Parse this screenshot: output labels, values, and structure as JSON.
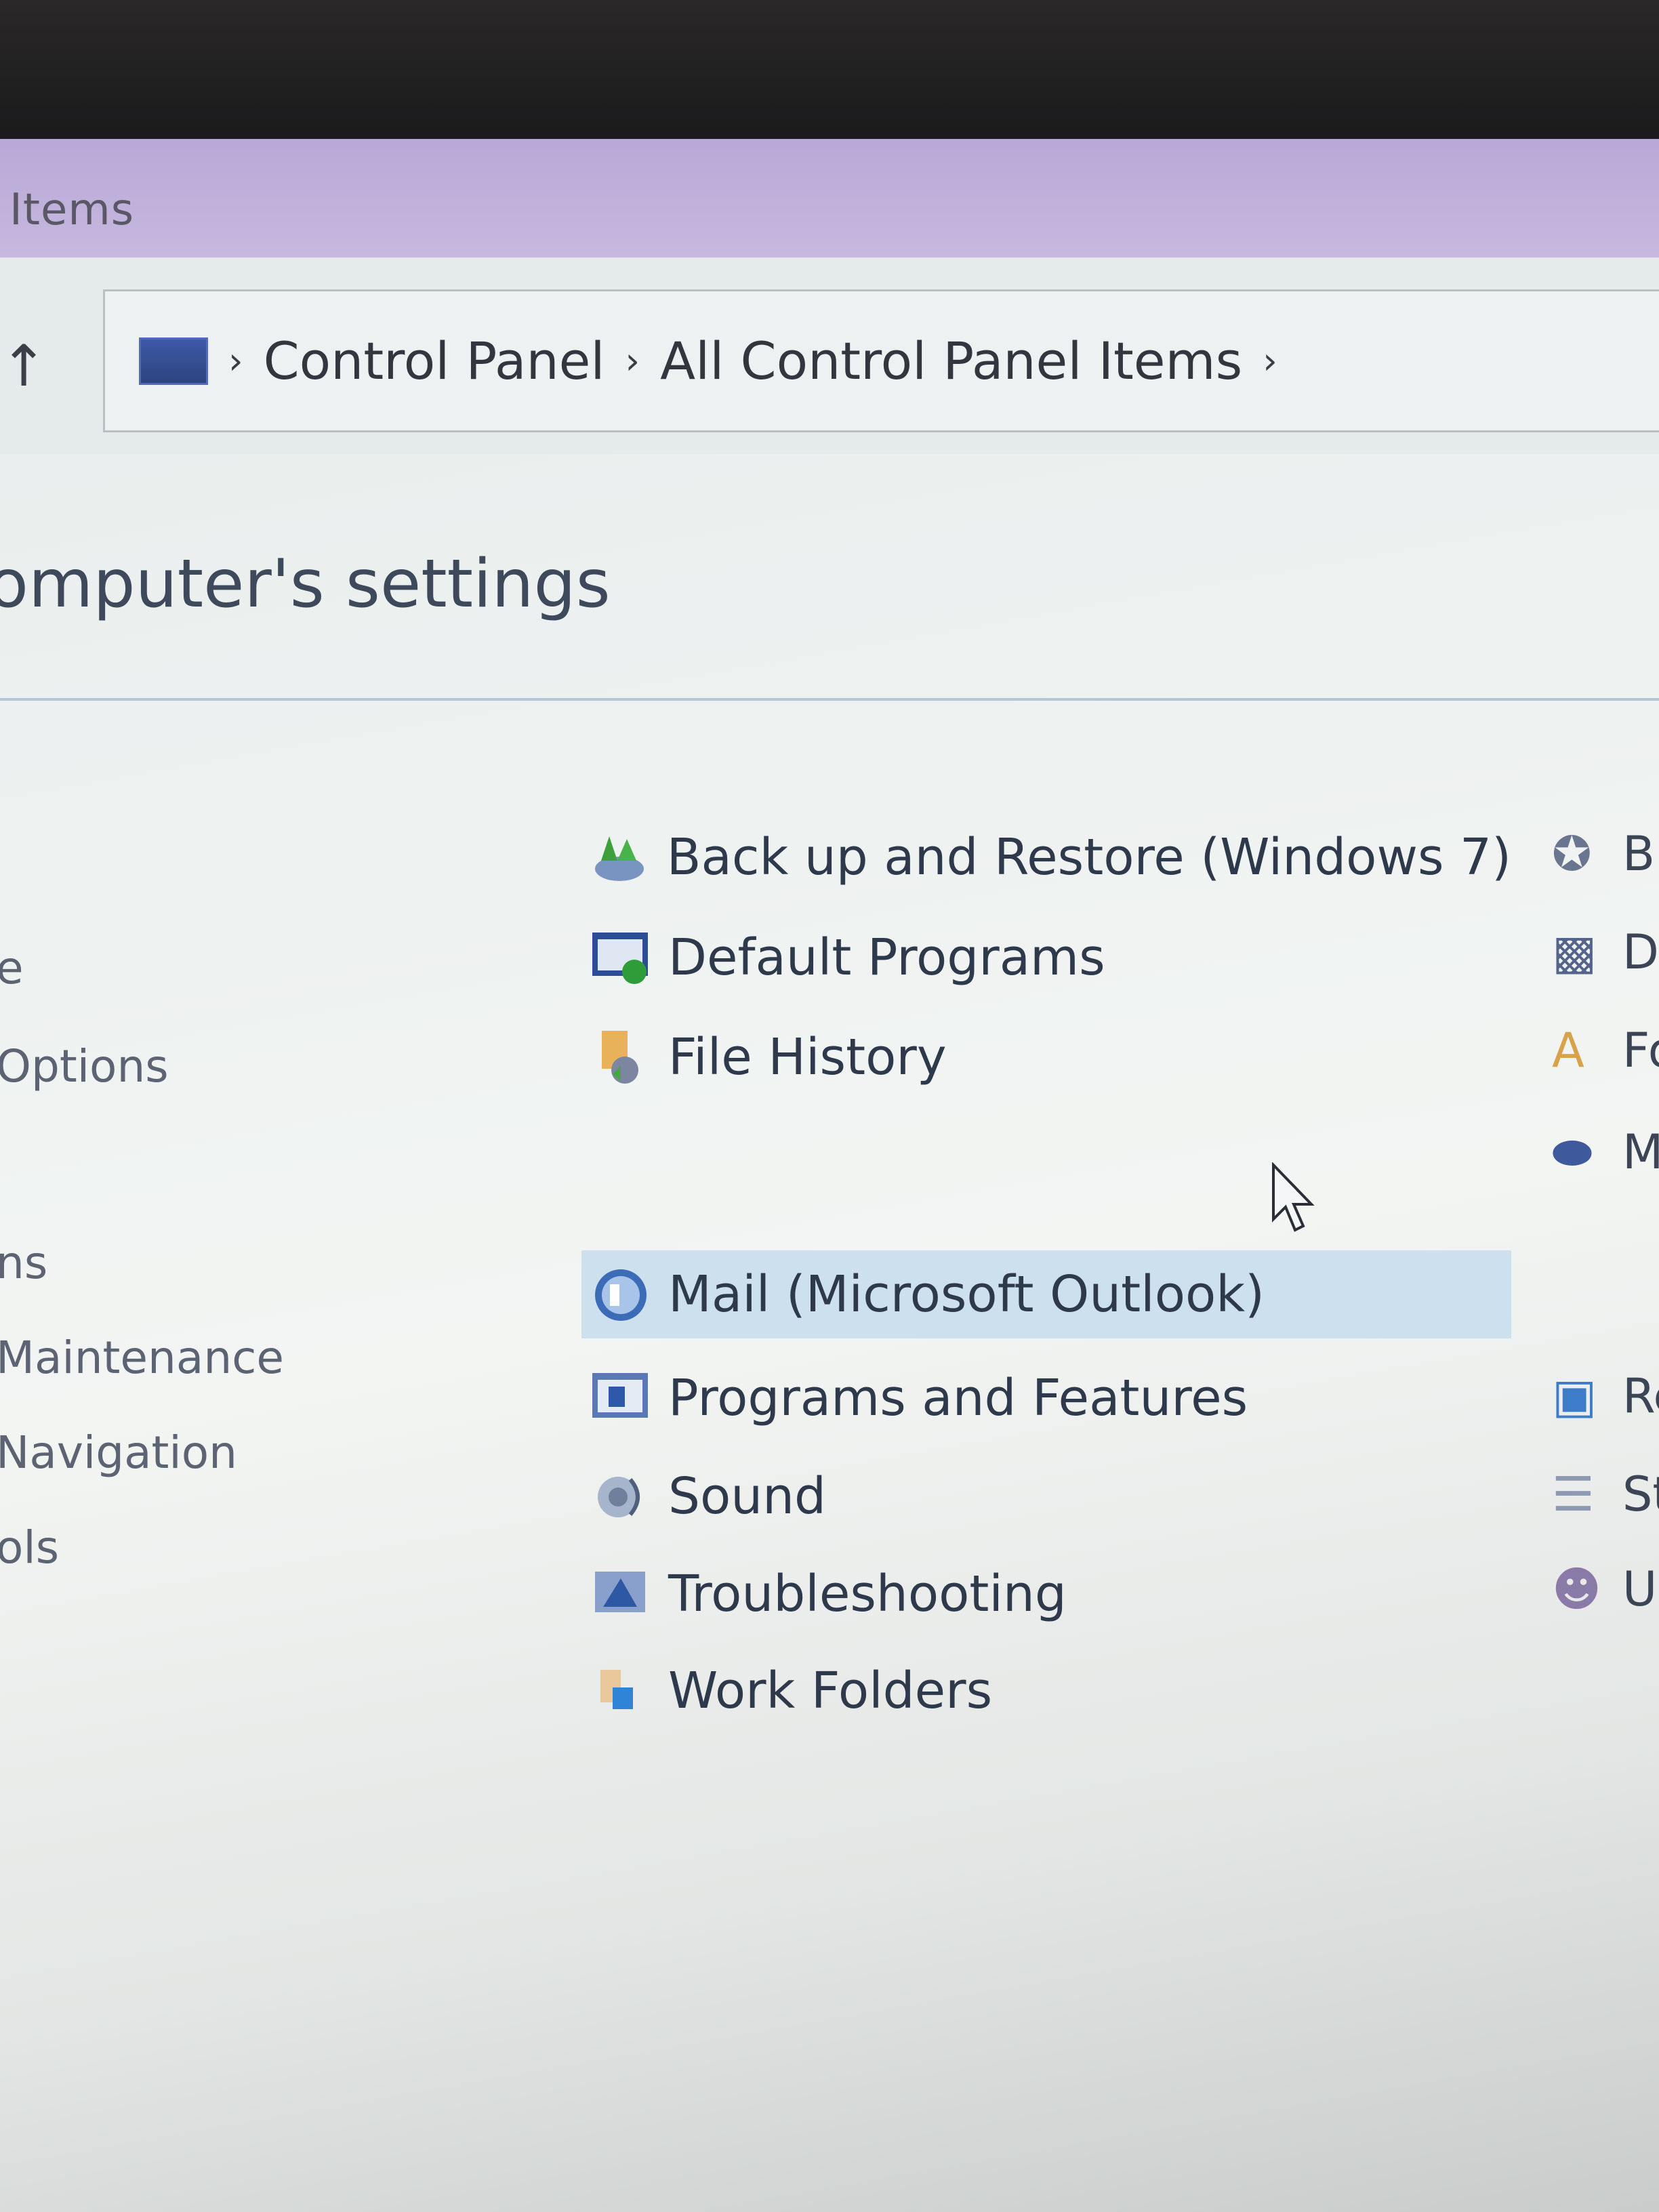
{
  "window": {
    "title": "Items"
  },
  "breadcrumb": {
    "root_icon": "computer-icon",
    "items": [
      "Control Panel",
      "All Control Panel Items"
    ]
  },
  "page": {
    "heading": "omputer's settings"
  },
  "left_column": [
    "e",
    "Options",
    "ns",
    "Maintenance",
    "Navigation",
    "ols"
  ],
  "center_column": [
    {
      "label": "Back up and Restore (Windows 7)",
      "icon": "backup-restore-icon"
    },
    {
      "label": "Default Programs",
      "icon": "default-programs-icon"
    },
    {
      "label": "File History",
      "icon": "file-history-icon"
    },
    {
      "label": "Mail (Microsoft Outlook)",
      "icon": "mail-icon",
      "hovered": true
    },
    {
      "label": "Programs and Features",
      "icon": "programs-features-icon"
    },
    {
      "label": "Sound",
      "icon": "sound-icon"
    },
    {
      "label": "Troubleshooting",
      "icon": "troubleshooting-icon"
    },
    {
      "label": "Work Folders",
      "icon": "work-folders-icon"
    }
  ],
  "right_column": [
    {
      "label": "B",
      "icon": "pin-icon"
    },
    {
      "label": "D",
      "icon": "device-icon"
    },
    {
      "label": "Fo",
      "icon": "font-icon"
    },
    {
      "label": "M",
      "icon": "mouse-icon"
    },
    {
      "label": "Re",
      "icon": "recovery-icon"
    },
    {
      "label": "St",
      "icon": "storage-icon"
    },
    {
      "label": "Us",
      "icon": "users-icon"
    }
  ],
  "colors": {
    "titlebar": "#c0b2dc",
    "hover": "#cde0ee",
    "text": "#2e3a4c"
  }
}
